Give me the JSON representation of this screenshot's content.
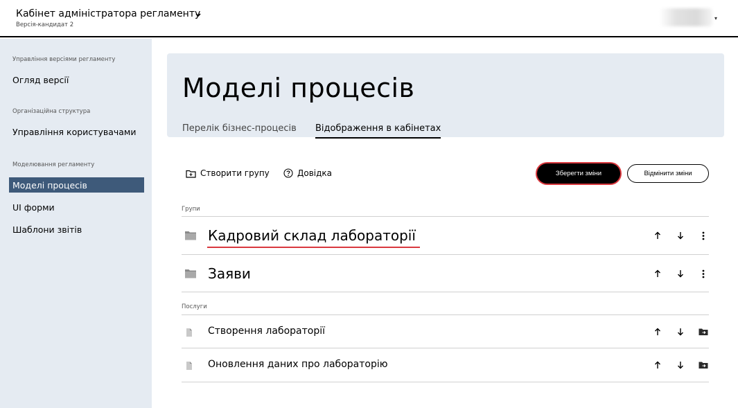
{
  "header": {
    "title": "Кабінет адміністратора регламенту",
    "subtitle": "Версія-кандидат 2",
    "caret": "⌄",
    "user_caret": "▾"
  },
  "sidebar": {
    "section_versions": "Управління версіями регламенту",
    "item_overview": "Огляд версії",
    "section_org": "Організаційна структура",
    "item_users": "Управління користувачами",
    "section_modeling": "Моделювання регламенту",
    "item_processes": "Моделі процесів",
    "item_ui_forms": "UI форми",
    "item_reports": "Шаблони звітів"
  },
  "hero": {
    "title": "Моделі процесів",
    "tabs": [
      {
        "label": "Перелік бізнес-процесів",
        "active": false
      },
      {
        "label": "Відображення в кабінетах",
        "active": true
      }
    ]
  },
  "toolbar": {
    "create_group": "Створити групу",
    "help": "Довідка",
    "save": "Зберегти зміни",
    "cancel": "Відмінити зміни"
  },
  "groups": {
    "label": "Групи",
    "items": [
      {
        "name": "Кадровий склад лабораторії"
      },
      {
        "name": "Заяви"
      }
    ]
  },
  "services": {
    "label": "Послуги",
    "items": [
      {
        "name": "Створення лабораторії"
      },
      {
        "name": "Оновлення даних про лабораторію"
      }
    ]
  },
  "colors": {
    "accent_dark": "#3e5a7a",
    "panel_bg": "#e5ebf2",
    "highlight_red": "#d9383e"
  }
}
